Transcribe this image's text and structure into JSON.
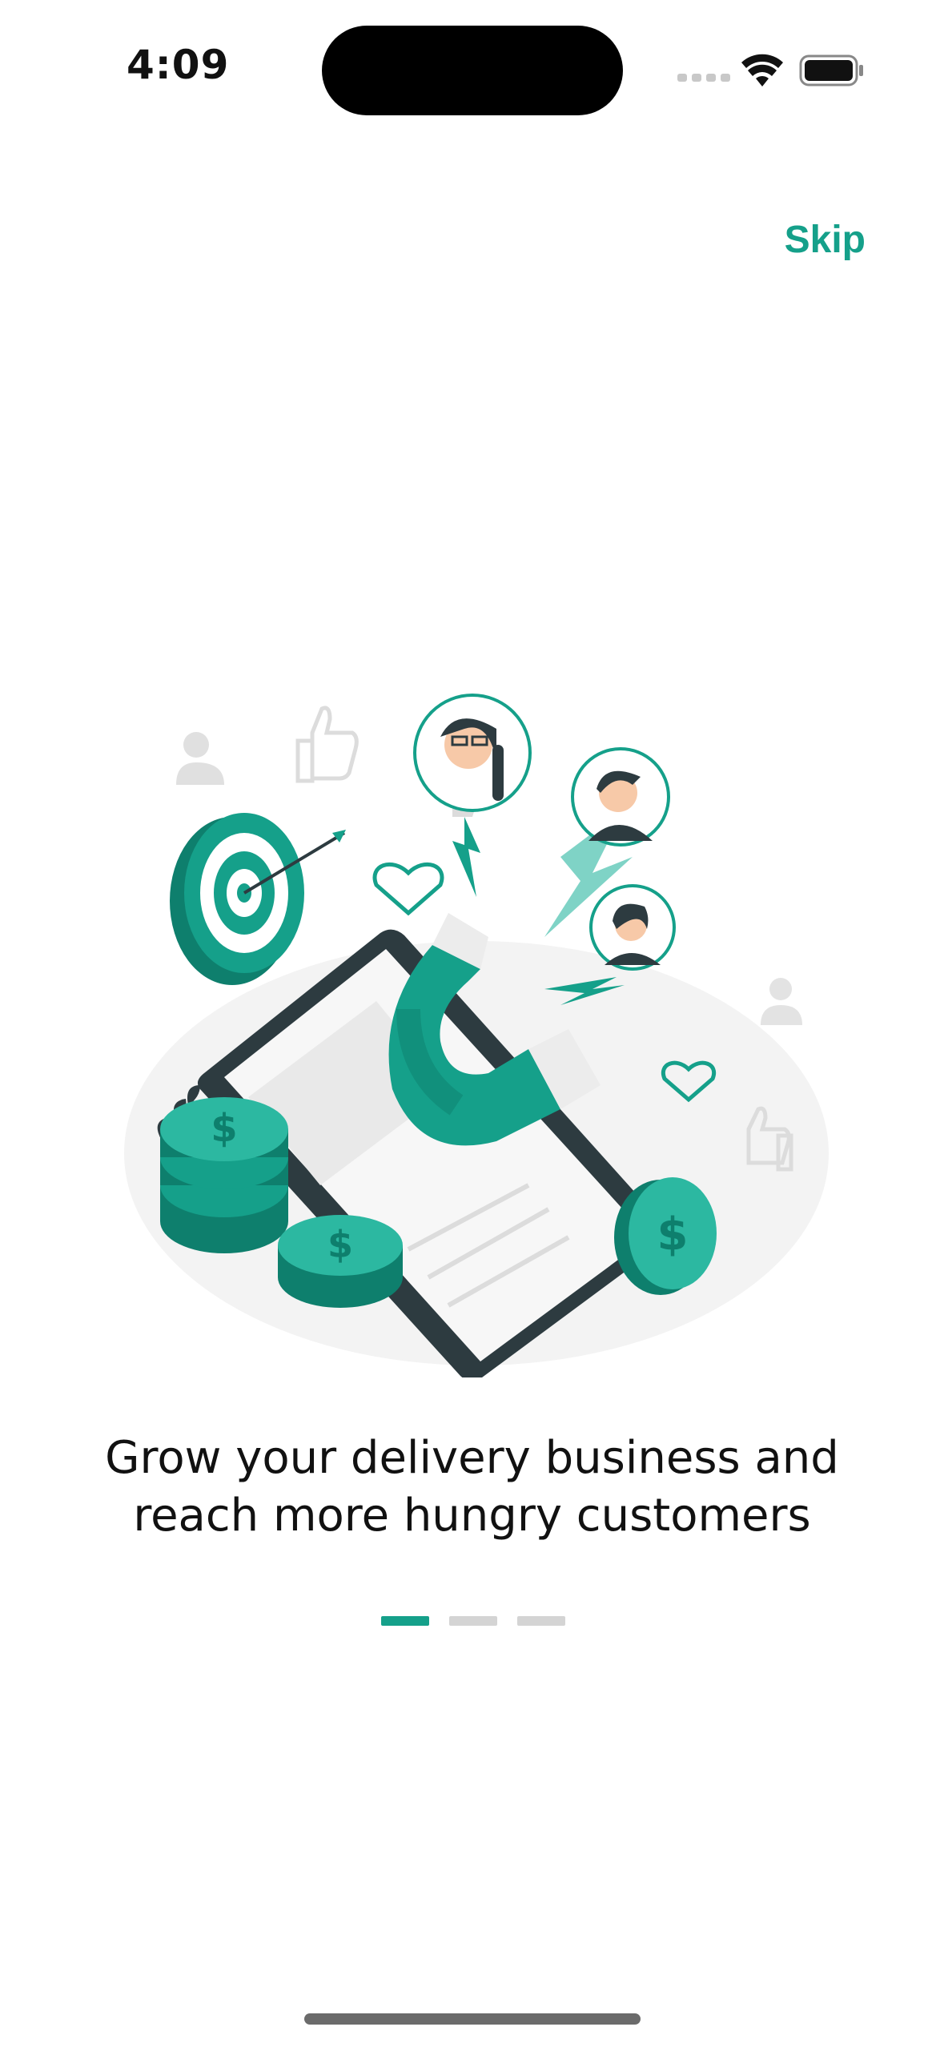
{
  "status_bar": {
    "time": "4:09"
  },
  "header": {
    "skip_label": "Skip"
  },
  "onboarding": {
    "headline_line1": "Grow your delivery business and",
    "headline_line2": "reach more hungry customers",
    "page_count": 3,
    "active_page": 1
  },
  "colors": {
    "accent": "#15a08a",
    "accent_dark": "#0e7f6d",
    "inactive_dot": "#d4d4d4"
  },
  "icons": [
    "wifi-icon",
    "battery-icon",
    "signal-icon",
    "target-icon",
    "magnet-icon",
    "coin-icon",
    "heart-icon",
    "like-icon",
    "user-icon"
  ]
}
